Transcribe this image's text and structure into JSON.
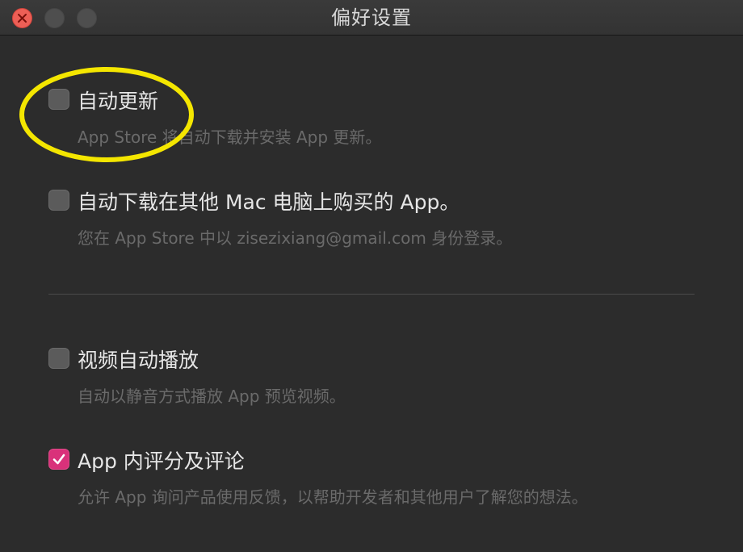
{
  "window": {
    "title": "偏好设置",
    "traffic_lights": [
      "close",
      "minimize",
      "zoom"
    ]
  },
  "options": [
    {
      "label": "自动更新",
      "description": "App Store 将自动下载并安装 App 更新。",
      "checked": false
    },
    {
      "label": "自动下载在其他 Mac 电脑上购买的 App。",
      "description": "您在 App Store 中以 zisezixiang@gmail.com 身份登录。",
      "checked": false
    },
    {
      "label": "视频自动播放",
      "description": "自动以静音方式播放 App 预览视频。",
      "checked": false
    },
    {
      "label": "App 内评分及评论",
      "description": "允许 App 询问产品使用反馈，以帮助开发者和其他用户了解您的想法。",
      "checked": true
    }
  ],
  "colors": {
    "background": "#2c2c2c",
    "accent": "#d9317a",
    "annotation": "#f4e600",
    "close_button": "#ed5f56"
  },
  "annotation": {
    "shape": "ellipse",
    "target": "自动更新"
  }
}
